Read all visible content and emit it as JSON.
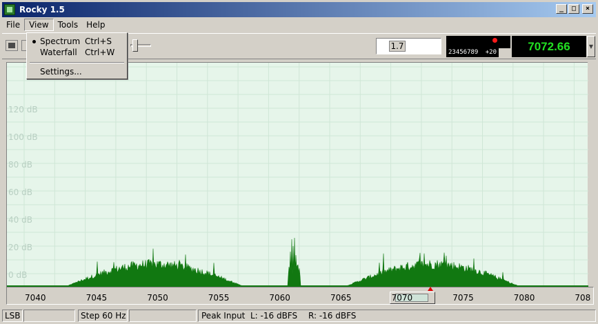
{
  "window": {
    "title": "Rocky 1.5",
    "buttons": {
      "minimize": "_",
      "maximize": "□",
      "close": "×"
    }
  },
  "menu": {
    "items": [
      "File",
      "View",
      "Tools",
      "Help"
    ]
  },
  "view_menu": {
    "items": [
      {
        "label": "Spectrum",
        "shortcut": "Ctrl+S",
        "checked": true
      },
      {
        "label": "Waterfall",
        "shortcut": "Ctrl+W",
        "checked": false
      },
      {
        "label": "Settings...",
        "shortcut": "",
        "checked": false
      }
    ]
  },
  "toolbar": {
    "value": "1.7",
    "digits": "23456789",
    "digits_extra": "+20",
    "frequency": "7072.66",
    "spin": "▼"
  },
  "spectrum": {
    "db_labels": [
      "120 dB",
      "100 dB",
      "80 dB",
      "60 dB",
      "40 dB",
      "20 dB",
      "0 dB"
    ],
    "freq_labels": [
      "7040",
      "7045",
      "7050",
      "7055",
      "7060",
      "7065",
      "7070",
      "7075",
      "7080",
      "708"
    ],
    "colors": {
      "background": "#e6f5ea",
      "grid": "#cfe6d6",
      "trace": "#117811",
      "label": "#b8cfc2"
    }
  },
  "status": {
    "mode": "LSB",
    "step": "Step 60 Hz",
    "peak_label": "Peak Input",
    "left": "L: -16 dBFS",
    "right": "R: -16 dBFS"
  }
}
